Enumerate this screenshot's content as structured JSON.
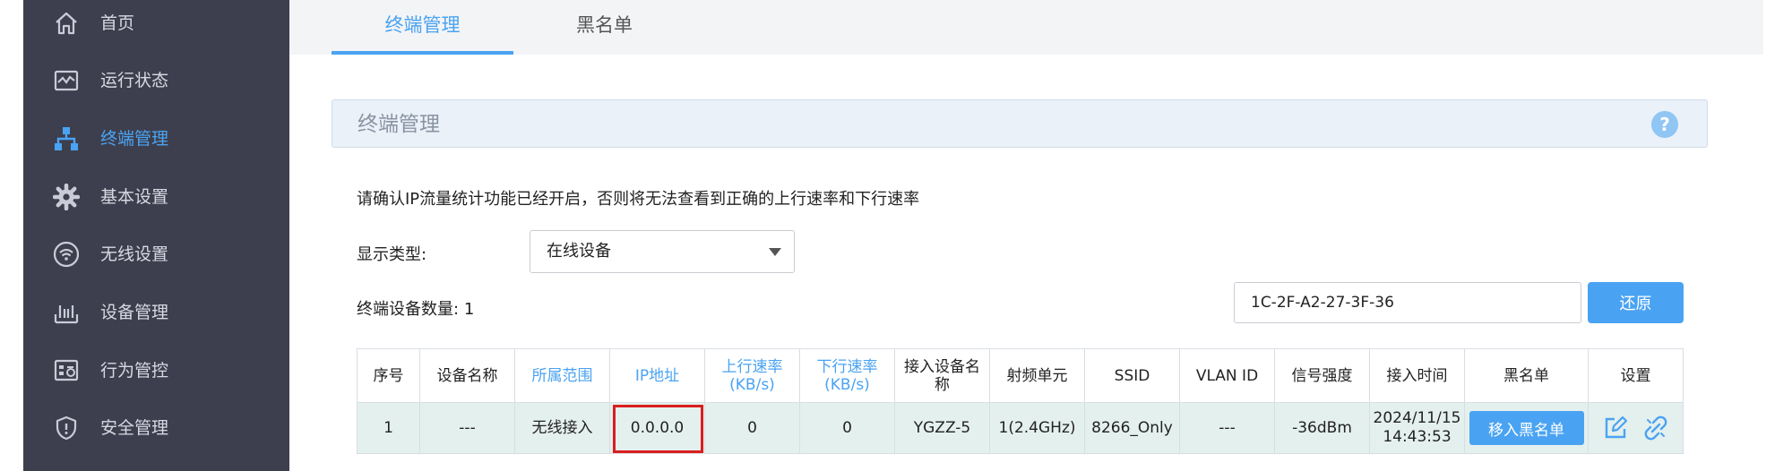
{
  "sidebar": {
    "items": [
      {
        "label": "首页",
        "icon": "home-icon"
      },
      {
        "label": "运行状态",
        "icon": "monitor-chart-icon"
      },
      {
        "label": "终端管理",
        "icon": "network-topology-icon",
        "active": true
      },
      {
        "label": "基本设置",
        "icon": "gear-icon"
      },
      {
        "label": "无线设置",
        "icon": "wifi-icon"
      },
      {
        "label": "设备管理",
        "icon": "router-icon"
      },
      {
        "label": "行为管控",
        "icon": "behavior-control-icon"
      },
      {
        "label": "安全管理",
        "icon": "shield-icon"
      }
    ]
  },
  "tabs": [
    {
      "label": "终端管理",
      "active": true
    },
    {
      "label": "黑名单",
      "active": false
    }
  ],
  "section": {
    "title": "终端管理",
    "help_icon": "?"
  },
  "notice": "请确认IP流量统计功能已经开启，否则将无法查看到正确的上行速率和下行速率",
  "filter": {
    "label": "显示类型:",
    "selected": "在线设备"
  },
  "count": {
    "label": "终端设备数量:",
    "value": "1"
  },
  "search": {
    "value": "1C-2F-A2-27-3F-36",
    "placeholder": ""
  },
  "restore_label": "还原",
  "table": {
    "headers": [
      {
        "label": "序号"
      },
      {
        "label": "设备名称"
      },
      {
        "label": "所属范围",
        "sortable": true
      },
      {
        "label": "IP地址",
        "sortable": true
      },
      {
        "label": "上行速率",
        "sub": "(KB/s)",
        "sortable": true
      },
      {
        "label": "下行速率",
        "sub": "(KB/s)",
        "sortable": true
      },
      {
        "label": "接入设备名",
        "sub": "称"
      },
      {
        "label": "射频单元"
      },
      {
        "label": "SSID"
      },
      {
        "label": "VLAN ID"
      },
      {
        "label": "信号强度"
      },
      {
        "label": "接入时间"
      },
      {
        "label": "黑名单"
      },
      {
        "label": "设置"
      }
    ],
    "rows": [
      {
        "index": "1",
        "device_name": "---",
        "scope": "无线接入",
        "ip": "0.0.0.0",
        "up_rate": "0",
        "down_rate": "0",
        "ap_name": "YGZZ-5",
        "radio": "1(2.4GHz)",
        "ssid": "8266_Only",
        "vlan": "---",
        "signal": "-36dBm",
        "time_date": "2024/11/15",
        "time_clock": "14:43:53",
        "blacklist_button": "移入黑名单"
      }
    ]
  },
  "colors": {
    "accent": "#4aa3f2",
    "sidebar_bg": "#3d3f4e",
    "highlight": "#d91e1e",
    "row_bg": "#e4f0ee"
  }
}
